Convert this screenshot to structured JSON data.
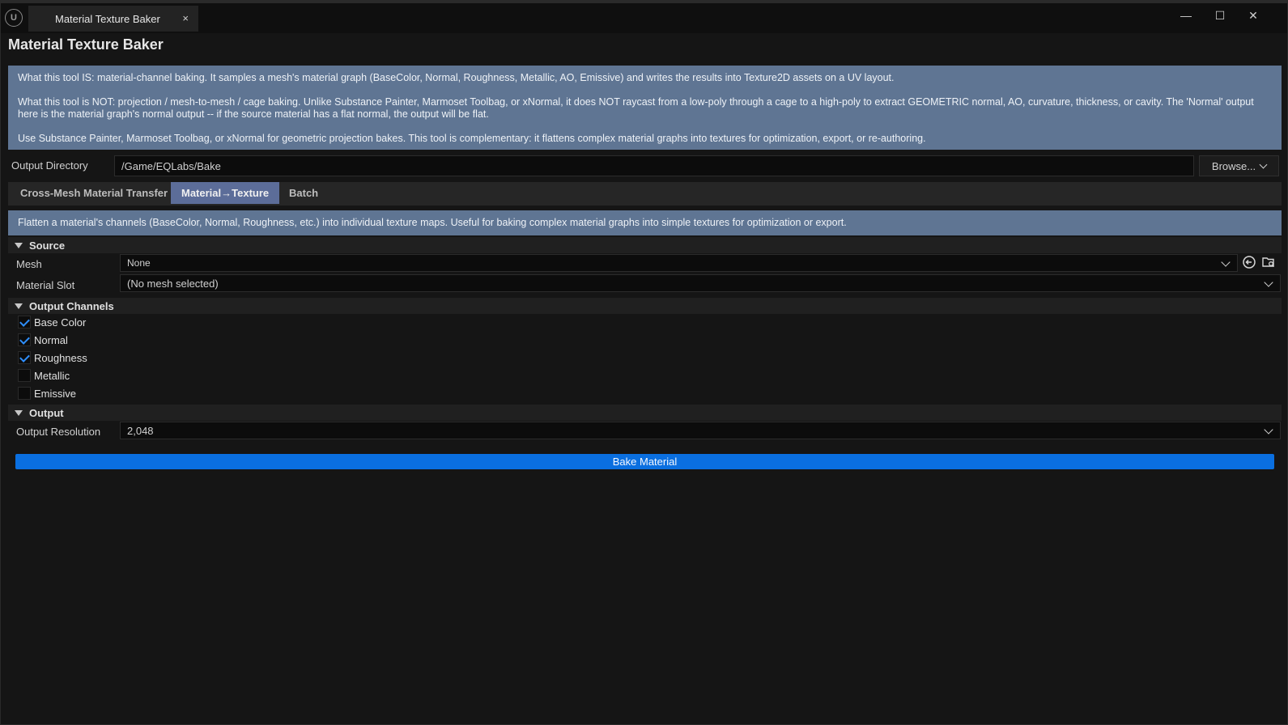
{
  "window": {
    "tab_title": "Material Texture Baker",
    "tab_close": "×",
    "controls": {
      "minimize": "—",
      "maximize": "☐",
      "close": "✕"
    }
  },
  "page_title": "Material Texture Baker",
  "info": {
    "p1": "What this tool IS: material-channel baking. It samples a mesh's material graph (BaseColor, Normal, Roughness, Metallic, AO, Emissive) and writes the results into Texture2D assets on a UV layout.",
    "p2": "What this tool is NOT: projection / mesh-to-mesh / cage baking. Unlike Substance Painter, Marmoset Toolbag, or xNormal, it does NOT raycast from a low-poly through a cage to a high-poly to extract GEOMETRIC normal, AO, curvature, thickness, or cavity. The 'Normal' output here is the material graph's normal output -- if the source material has a flat normal, the output will be flat.",
    "p3": "Use Substance Painter, Marmoset Toolbag, or xNormal for geometric projection bakes. This tool is complementary: it flattens complex material graphs into textures for optimization, export, or re-authoring."
  },
  "output_directory": {
    "label": "Output Directory",
    "value": "/Game/EQLabs/Bake",
    "browse_label": "Browse..."
  },
  "tabs": [
    {
      "label": "Cross-Mesh Material Transfer",
      "active": false
    },
    {
      "label": "Material→Texture",
      "active": true
    },
    {
      "label": "Batch",
      "active": false
    }
  ],
  "description": "Flatten a material's channels (BaseColor, Normal, Roughness, etc.) into individual texture maps. Useful for baking complex material graphs into simple textures for optimization or export.",
  "source": {
    "header": "Source",
    "mesh_label": "Mesh",
    "mesh_value": "None",
    "slot_label": "Material Slot",
    "slot_value": "(No mesh selected)"
  },
  "channels": {
    "header": "Output Channels",
    "items": [
      {
        "label": "Base Color",
        "checked": true
      },
      {
        "label": "Normal",
        "checked": true
      },
      {
        "label": "Roughness",
        "checked": true
      },
      {
        "label": "Metallic",
        "checked": false
      },
      {
        "label": "Emissive",
        "checked": false
      }
    ]
  },
  "output": {
    "header": "Output",
    "resolution_label": "Output Resolution",
    "resolution_value": "2,048"
  },
  "bake_label": "Bake Material",
  "colors": {
    "accent": "#0a6fe0",
    "banner": "#5f7593",
    "active_tab": "#5c6d99",
    "check": "#2f8fff"
  }
}
